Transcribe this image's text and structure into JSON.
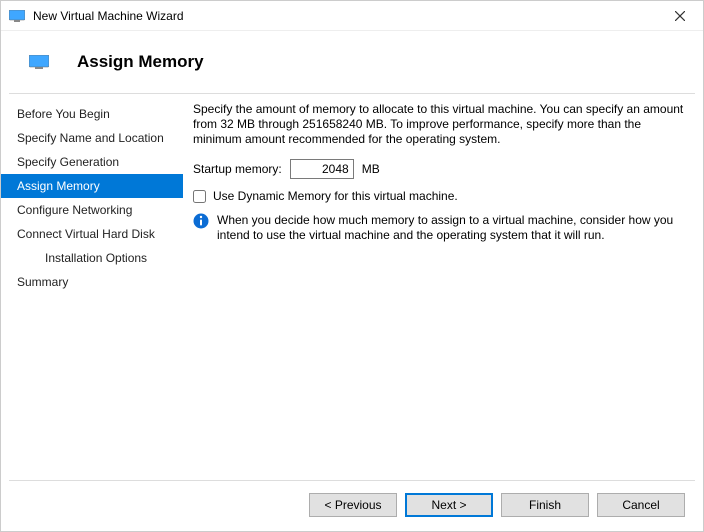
{
  "window": {
    "title": "New Virtual Machine Wizard"
  },
  "header": {
    "page_title": "Assign Memory"
  },
  "sidebar": {
    "items": [
      {
        "label": "Before You Begin"
      },
      {
        "label": "Specify Name and Location"
      },
      {
        "label": "Specify Generation"
      },
      {
        "label": "Assign Memory"
      },
      {
        "label": "Configure Networking"
      },
      {
        "label": "Connect Virtual Hard Disk"
      },
      {
        "label": "Installation Options"
      },
      {
        "label": "Summary"
      }
    ]
  },
  "content": {
    "intro": "Specify the amount of memory to allocate to this virtual machine. You can specify an amount from 32 MB through 251658240 MB. To improve performance, specify more than the minimum amount recommended for the operating system.",
    "startup_label": "Startup memory:",
    "startup_value": "2048",
    "startup_unit": "MB",
    "dynamic_label": "Use Dynamic Memory for this virtual machine.",
    "info_text": "When you decide how much memory to assign to a virtual machine, consider how you intend to use the virtual machine and the operating system that it will run."
  },
  "footer": {
    "previous": "< Previous",
    "next": "Next >",
    "finish": "Finish",
    "cancel": "Cancel"
  }
}
